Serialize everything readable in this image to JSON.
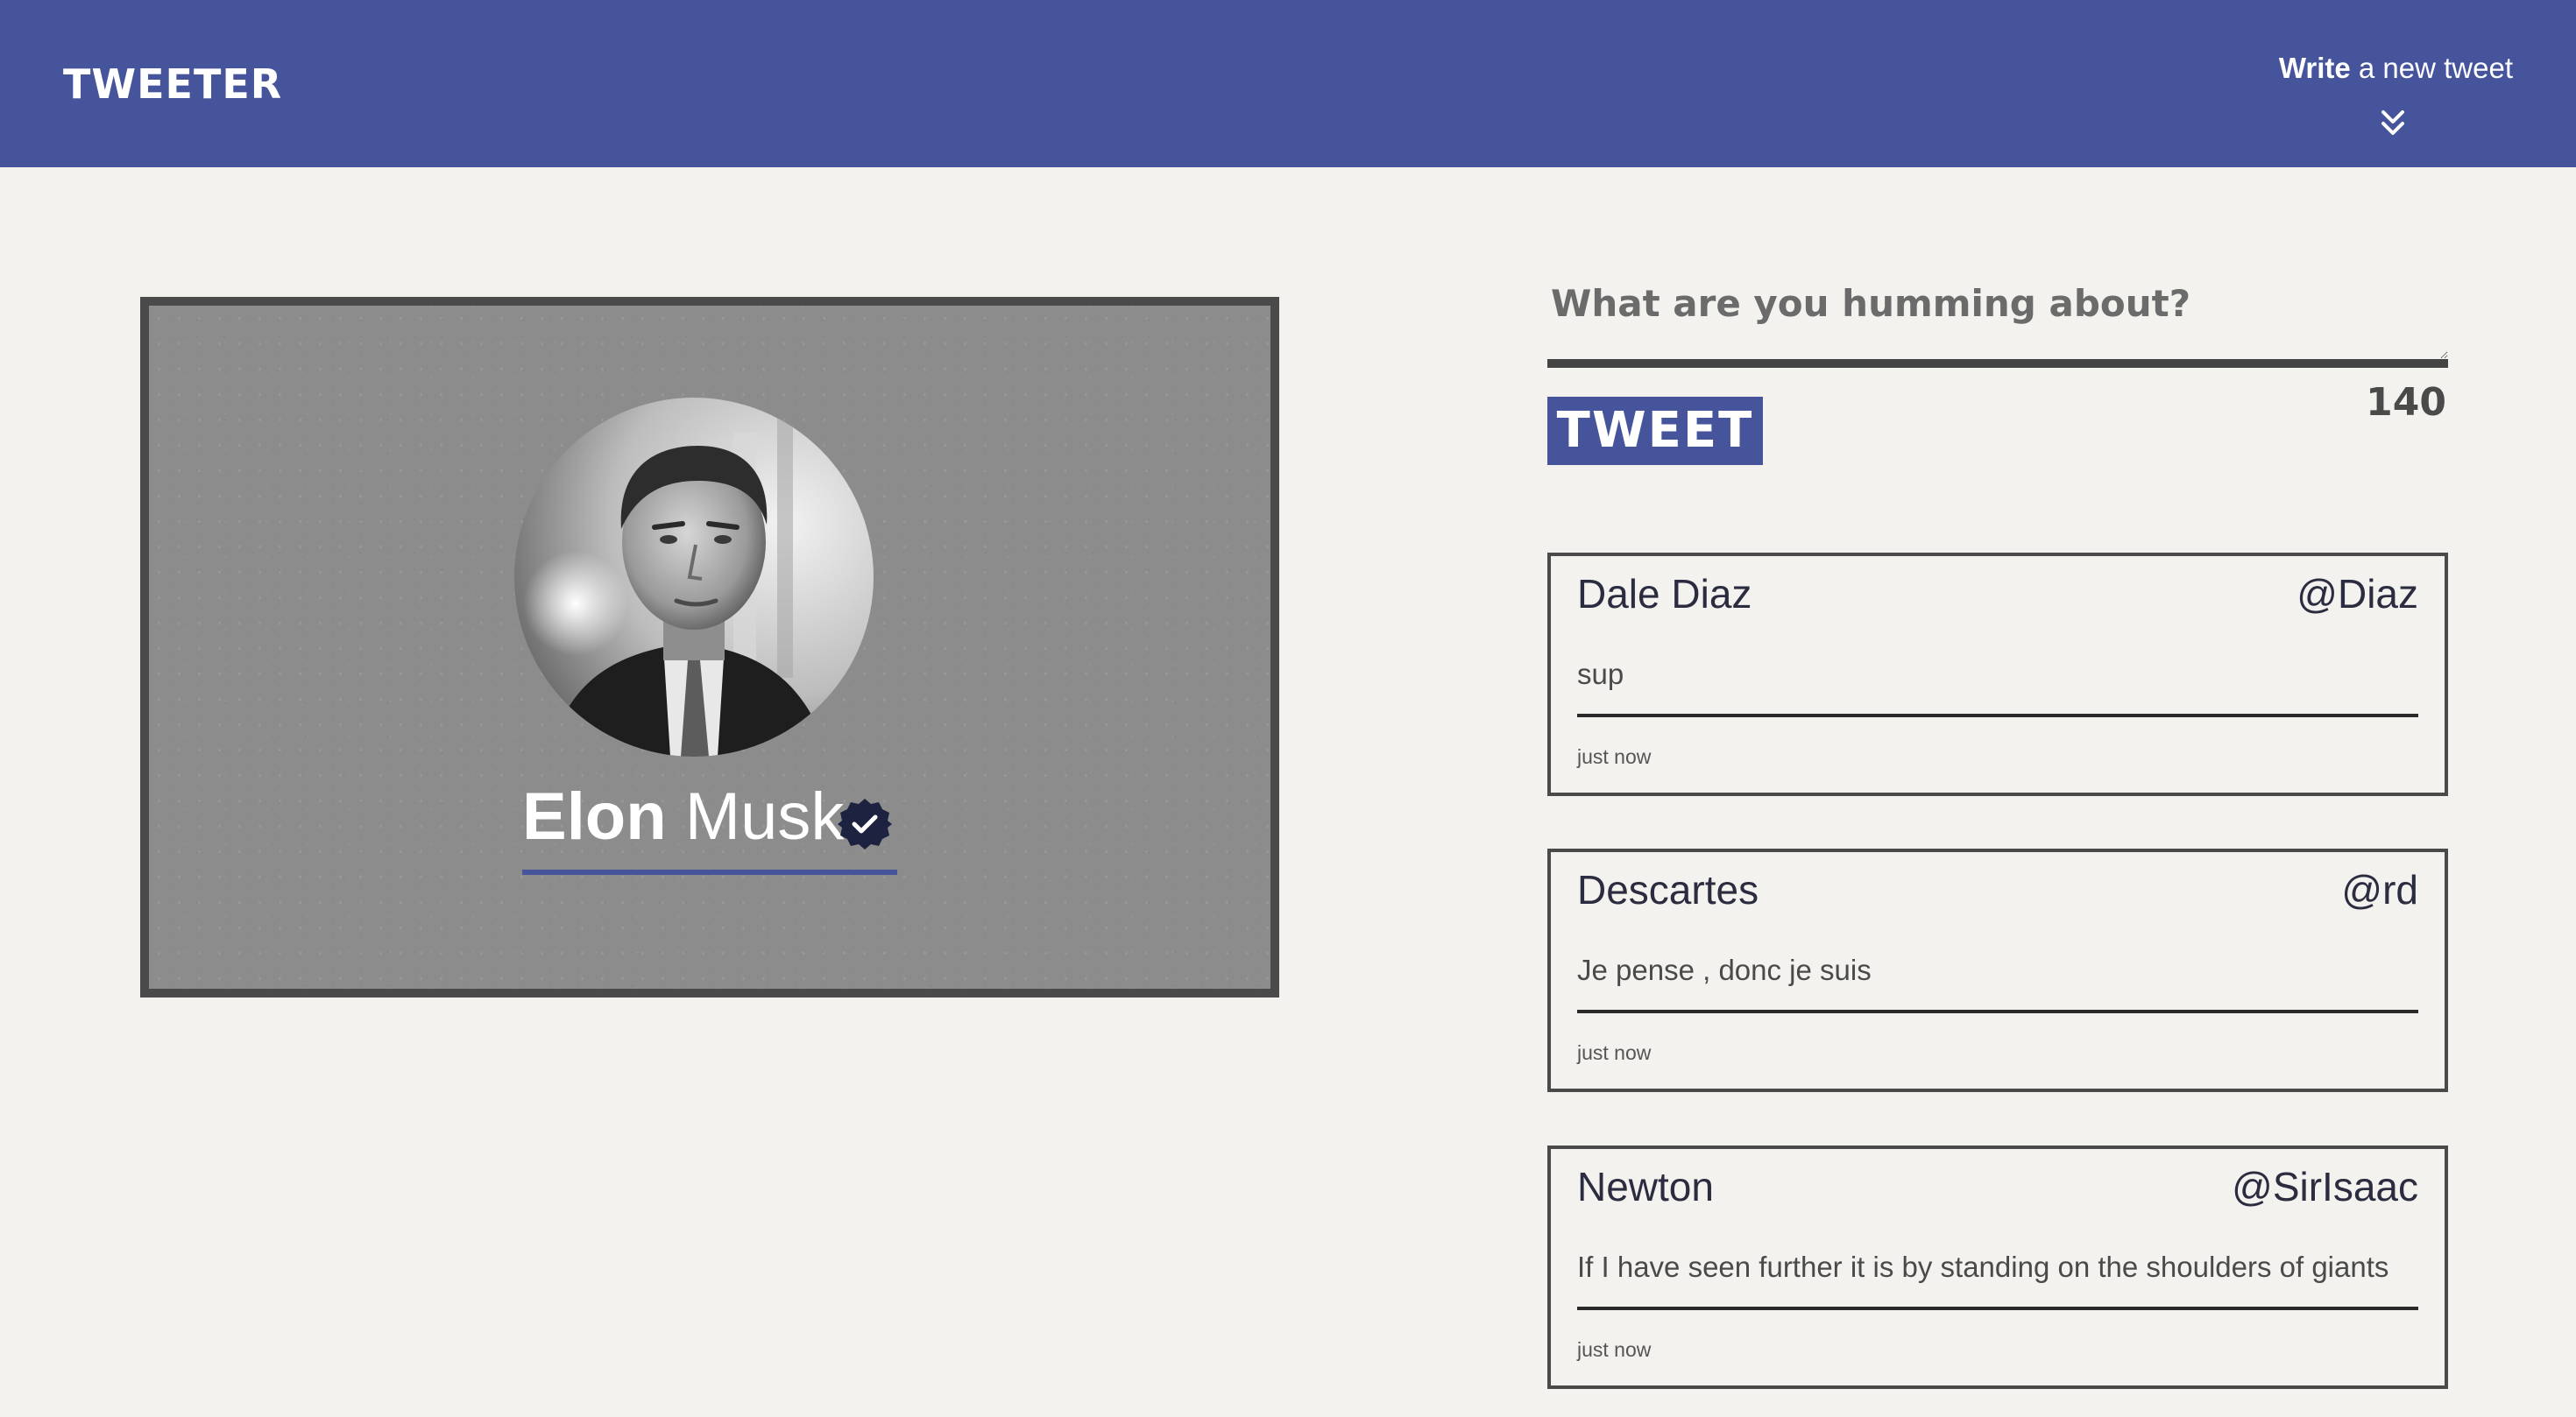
{
  "header": {
    "brand": "TWEETER",
    "compose_link": {
      "bold": "Write",
      "rest": " a new tweet"
    },
    "compose_icon": "double-chevron-down-icon",
    "background_color": "#45549b"
  },
  "profile": {
    "first_name": "Elon",
    "last_name": "Musk",
    "avatar_icon": "avatar-photo",
    "verified_icon": "verified-badge-icon",
    "accent_color": "#45549b"
  },
  "composer": {
    "placeholder": "What are you humming about?",
    "value": "",
    "button_label": "TWEET",
    "char_count": "140"
  },
  "tweets": [
    {
      "name": "Dale Diaz",
      "handle": "@Diaz",
      "text": "sup",
      "time": "just now"
    },
    {
      "name": "Descartes",
      "handle": "@rd",
      "text": "Je pense , donc je suis",
      "time": "just now"
    },
    {
      "name": "Newton",
      "handle": "@SirIsaac",
      "text": "If I have seen further it is by standing on the shoulders of giants",
      "time": "just now"
    }
  ]
}
